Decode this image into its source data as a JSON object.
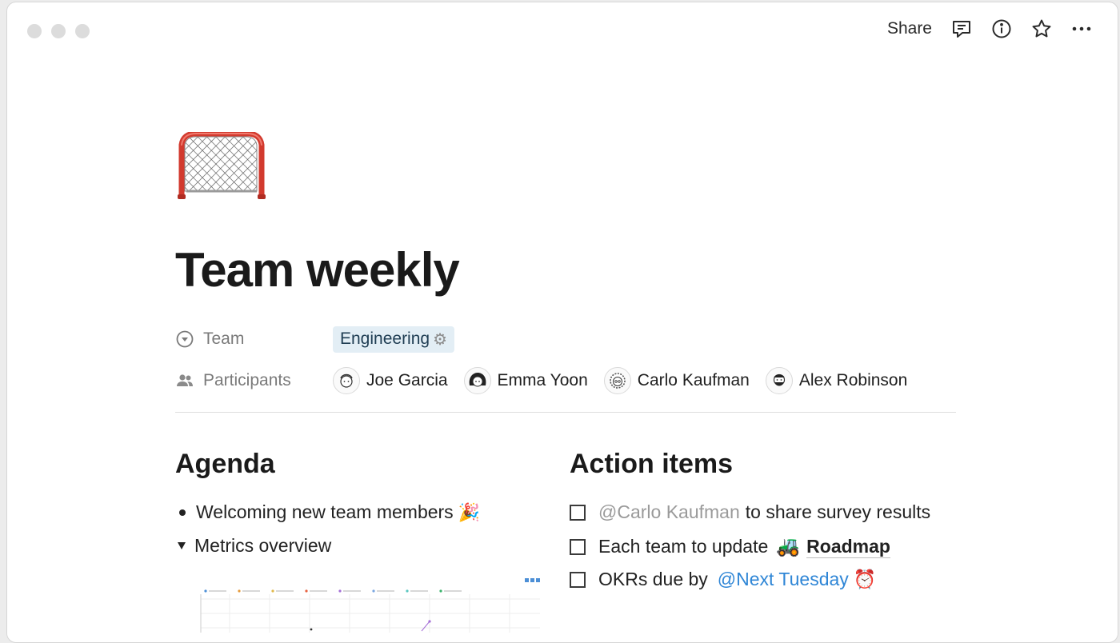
{
  "topbar": {
    "share_label": "Share",
    "icons": [
      "comment-icon",
      "info-icon",
      "star-icon",
      "more-icon"
    ]
  },
  "page": {
    "icon": "hockey-goal-icon",
    "title": "Team weekly"
  },
  "properties": {
    "team": {
      "label": "Team",
      "icon": "select-icon",
      "value": "Engineering",
      "value_icon": "gear-icon"
    },
    "participants": {
      "label": "Participants",
      "icon": "people-icon",
      "people": [
        "Joe Garcia",
        "Emma Yoon",
        "Carlo Kaufman",
        "Alex Robinson"
      ]
    }
  },
  "agenda": {
    "heading": "Agenda",
    "items": [
      {
        "text": "Welcoming new team members",
        "emoji": "🎉",
        "marker": "bullet"
      },
      {
        "text": "Metrics overview",
        "marker": "toggle-open"
      }
    ],
    "chart_colors": [
      "#4c8fd6",
      "#e59a3a",
      "#e0b84a",
      "#e7603e",
      "#a56fd6",
      "#7aa6e0",
      "#59c6c0",
      "#38b26b"
    ]
  },
  "action_items": {
    "heading": "Action items",
    "items": [
      {
        "mention": "@Carlo Kaufman",
        "text": "to share survey results",
        "checked": false
      },
      {
        "text": "Each team to update",
        "link_emoji": "🚜",
        "link": "Roadmap",
        "checked": false
      },
      {
        "text": "OKRs due by",
        "date_mention": "@Next Tuesday",
        "date_icon": "alarm-clock-icon",
        "checked": false
      }
    ]
  },
  "colors": {
    "tag_background": "#e3eef5",
    "mention_blue": "#2f86d6",
    "muted_text": "#7a7a7a"
  }
}
